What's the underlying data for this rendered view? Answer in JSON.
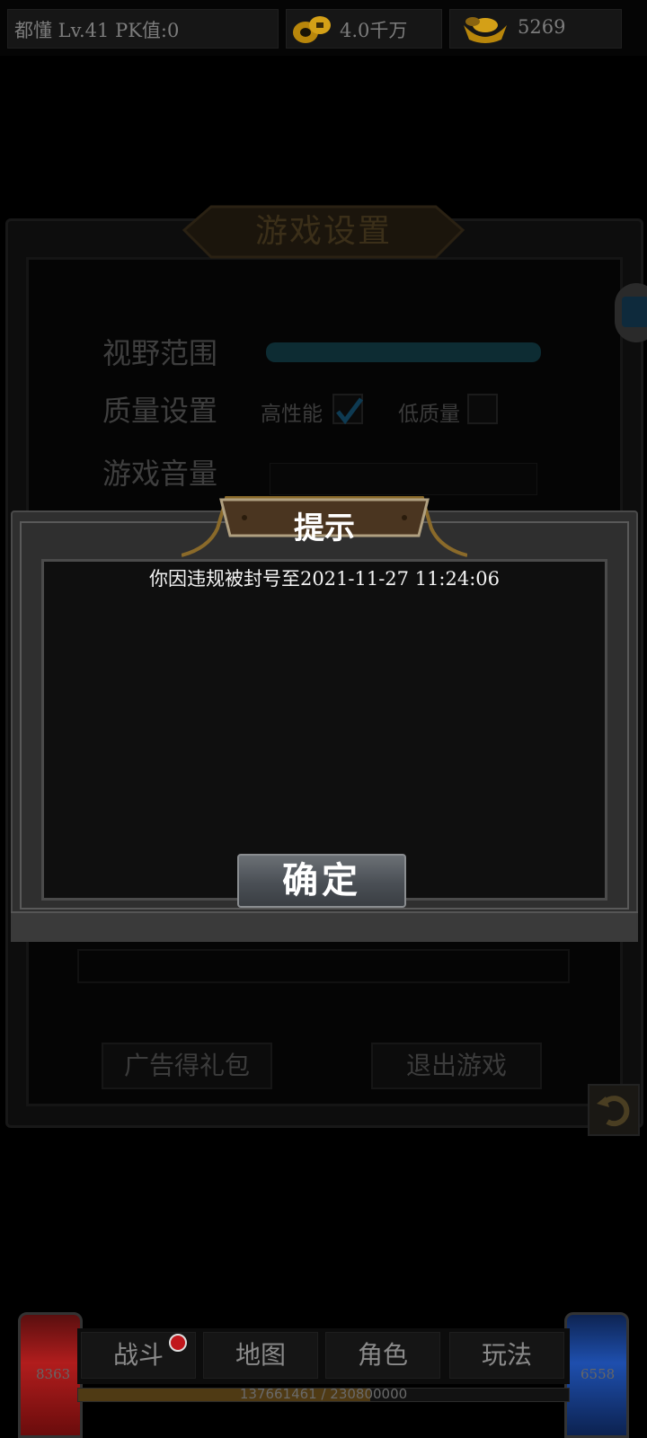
{
  "topbar": {
    "player_info": "都懂  Lv.41 PK值:0",
    "gold": "4.0千万",
    "ingot": "5269"
  },
  "settings": {
    "title": "游戏设置",
    "view_range_label": "视野范围",
    "quality_label": "质量设置",
    "high_performance_label": "高性能",
    "low_quality_label": "低质量",
    "high_performance_checked": true,
    "low_quality_checked": false,
    "volume_label": "游戏音量",
    "ad_gift_button": "广告得礼包",
    "exit_game_button": "退出游戏"
  },
  "dialog": {
    "title": "提示",
    "message": "你因违规被封号至2021-11-27 11:24:06",
    "confirm_button": "确定"
  },
  "hud": {
    "hp_value": "8363",
    "mp_value": "6558",
    "tabs": [
      "战斗",
      "地图",
      "角色",
      "玩法"
    ],
    "exp_text": "137661461 / 230800000",
    "exp_fraction": 0.596
  },
  "colors": {
    "dialog_title": "#ffffff",
    "hp": "#b11d1d",
    "mp": "#1e4fae",
    "notification_dot": "#c0171c"
  },
  "icons": {
    "gold": "gold-coins-icon",
    "ingot": "gold-ingot-icon",
    "side": "cube-icon",
    "return": "return-arrow-icon"
  }
}
